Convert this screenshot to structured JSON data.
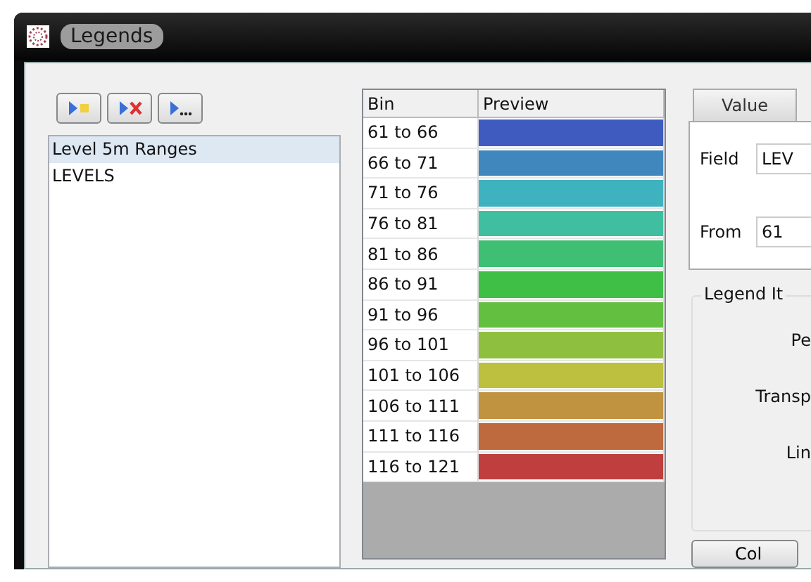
{
  "window": {
    "title": "Legends"
  },
  "toolbar": [
    {
      "kind": "add"
    },
    {
      "kind": "delete"
    },
    {
      "kind": "more"
    }
  ],
  "legend_list": [
    {
      "label": "Level 5m Ranges",
      "selected": true
    },
    {
      "label": "LEVELS",
      "selected": false
    }
  ],
  "grid": {
    "columns": [
      "Bin",
      "Preview"
    ],
    "rows": [
      {
        "bin": "61 to 66",
        "color": "#3f5bbf"
      },
      {
        "bin": "66 to 71",
        "color": "#3f87bd"
      },
      {
        "bin": "71 to 76",
        "color": "#3fb2bf"
      },
      {
        "bin": "76 to 81",
        "color": "#3fbf9f"
      },
      {
        "bin": "81 to 86",
        "color": "#3fbf74"
      },
      {
        "bin": "86 to 91",
        "color": "#3fbf46"
      },
      {
        "bin": "91 to 96",
        "color": "#63bf3f"
      },
      {
        "bin": "96 to 101",
        "color": "#8fbf3f"
      },
      {
        "bin": "101 to 106",
        "color": "#bdbf3f"
      },
      {
        "bin": "106 to 111",
        "color": "#bf933f"
      },
      {
        "bin": "111 to 116",
        "color": "#bf693f"
      },
      {
        "bin": "116 to 121",
        "color": "#bf3f3f"
      }
    ]
  },
  "tabs": [
    {
      "label": "Value",
      "selected": true
    }
  ],
  "value_panel": {
    "fields": [
      {
        "label": "Field",
        "value": "LEV"
      },
      {
        "label": "From",
        "value": "61"
      }
    ]
  },
  "legend_group": {
    "title": "Legend It",
    "labels": [
      "Pe",
      "Transp",
      "Lin"
    ]
  },
  "bottom_button": "Col"
}
